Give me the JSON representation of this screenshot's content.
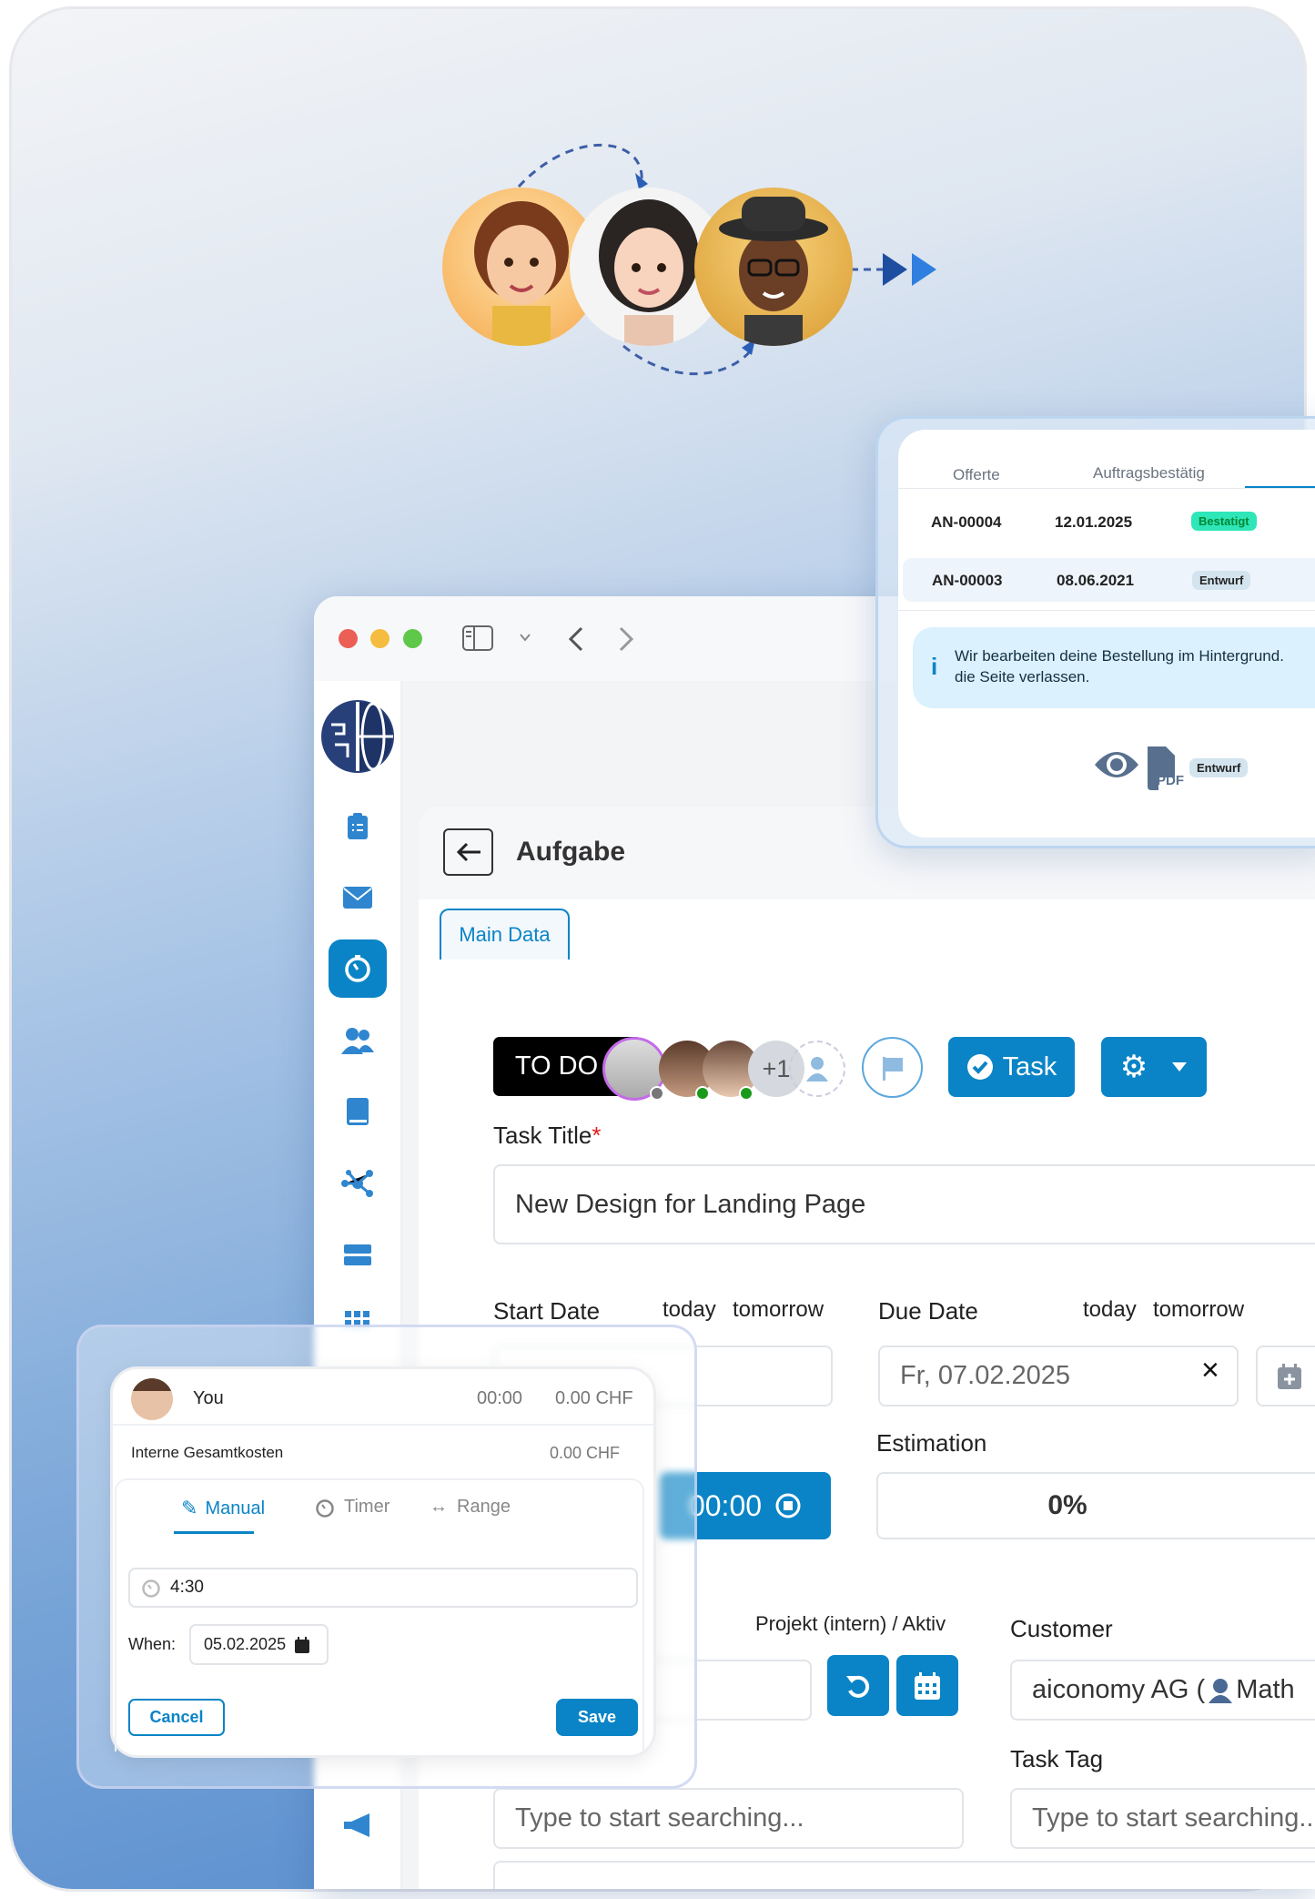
{
  "colors": {
    "accent": "#0a84c6",
    "todo_bg": "#000000",
    "badge_confirmed": "#2ee6b8",
    "badge_draft": "#d3e4ee",
    "info_bg": "#dbf1fd"
  },
  "orders": {
    "tabs": [
      "Offerte",
      "Auftragsbestätig"
    ],
    "rows": [
      {
        "number": "AN-00004",
        "date": "12.01.2025",
        "status": "Bestatigt"
      },
      {
        "number": "AN-00003",
        "date": "08.06.2021",
        "status": "Entwurf"
      }
    ],
    "info_line1": "Wir bearbeiten deine Bestellung im Hintergrund.",
    "info_line2": "die Seite verlassen.",
    "info_icon": "i",
    "pdf_label": "PDF",
    "pdf_status": "Entwurf"
  },
  "sidebar": {
    "items": [
      {
        "icon": "clipboard-list-icon"
      },
      {
        "icon": "envelope-icon"
      },
      {
        "icon": "stopwatch-icon",
        "active": true
      },
      {
        "icon": "users-icon"
      },
      {
        "icon": "book-icon"
      },
      {
        "icon": "network-icon"
      },
      {
        "icon": "server-icon"
      },
      {
        "icon": "grid-icon"
      },
      {
        "icon": "megaphone-icon"
      }
    ]
  },
  "page": {
    "title": "Aufgabe",
    "tabs": [
      "Main Data"
    ],
    "status_button": "TO DO",
    "assignee_extra": "+1",
    "type_button": "Task",
    "task_title_label": "Task Title",
    "required_mark": "*",
    "task_title_value": "New Design for Landing Page",
    "start_date_label": "Start Date",
    "due_date_label": "Due Date",
    "today": "today",
    "tomorrow": "tomorrow",
    "due_date_value": "Fr, 07.02.2025",
    "clear_symbol": "×",
    "estimation_label": "Estimation",
    "timer_value": "00:00",
    "estimation_value": "0%",
    "project_meta": "Projekt (intern) / Aktiv",
    "customer_label": "Customer",
    "customer_value": "aiconomy AG (",
    "customer_contact": "Math",
    "task_tag_label": "Task Tag",
    "search_placeholder": "Type to start searching..."
  },
  "timer_panel": {
    "user": "You",
    "time": "00:00",
    "cost": "0.00 CHF",
    "internal_label": "Interne Gesamtkosten",
    "internal_cost": "0.00 CHF",
    "modes": [
      "Manual",
      "Timer",
      "Range"
    ],
    "active_mode": "Manual",
    "duration_value": "4:30",
    "when_label": "When:",
    "when_value": "05.02.2025",
    "cancel": "Cancel",
    "save": "Save"
  }
}
